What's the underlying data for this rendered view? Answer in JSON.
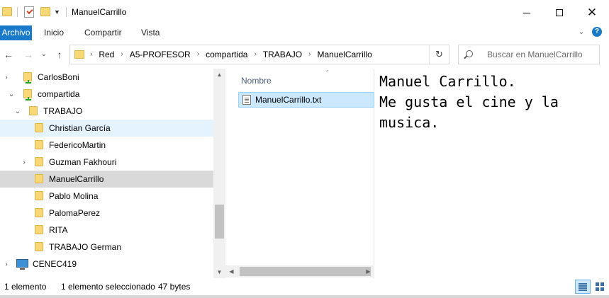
{
  "window": {
    "title": "ManuelCarrillo",
    "minimize_glyph": "—",
    "close_glyph": "✕"
  },
  "ribbon": {
    "tabs": [
      "Archivo",
      "Inicio",
      "Compartir",
      "Vista"
    ],
    "active_tab": "Archivo",
    "accent_color": "#1979ca"
  },
  "nav": {
    "back_glyph": "←",
    "forward_glyph": "→",
    "recent_glyph": "⌄",
    "up_glyph": "↑",
    "breadcrumbs": [
      "Red",
      "A5-PROFESOR",
      "compartida",
      "TRABAJO",
      "ManuelCarrillo"
    ],
    "crumb_separator": "›",
    "refresh_glyph": "↻",
    "search_placeholder": "Buscar en ManuelCarrillo"
  },
  "tree": {
    "items": [
      {
        "label": "CarlosBoni",
        "icon": "shared-folder-icon",
        "expander": "›"
      },
      {
        "label": "compartida",
        "icon": "shared-folder-icon",
        "expander": "⌄"
      },
      {
        "label": "TRABAJO",
        "icon": "folder-icon",
        "expander": "⌄"
      },
      {
        "label": "Christian García",
        "icon": "folder-icon",
        "state": "hover"
      },
      {
        "label": "FedericoMartin",
        "icon": "folder-icon"
      },
      {
        "label": "Guzman Fakhouri",
        "icon": "folder-icon",
        "expander": "›"
      },
      {
        "label": "ManuelCarrillo",
        "icon": "folder-icon",
        "state": "selected"
      },
      {
        "label": "Pablo Molina",
        "icon": "folder-icon"
      },
      {
        "label": "PalomaPerez",
        "icon": "folder-icon"
      },
      {
        "label": "RITA",
        "icon": "folder-icon"
      },
      {
        "label": "TRABAJO German",
        "icon": "folder-icon"
      },
      {
        "label": "CENEC419",
        "icon": "computer-icon",
        "expander": "›"
      }
    ]
  },
  "filelist": {
    "column_name": "Nombre",
    "files": [
      {
        "name": "ManuelCarrillo.txt",
        "icon": "text-file-icon",
        "selected": true
      }
    ]
  },
  "preview": {
    "content": "Manuel Carrillo.\nMe gusta el cine y la musica."
  },
  "status": {
    "item_count": "1 elemento",
    "selection": "1 elemento seleccionado",
    "size": "47 bytes"
  }
}
